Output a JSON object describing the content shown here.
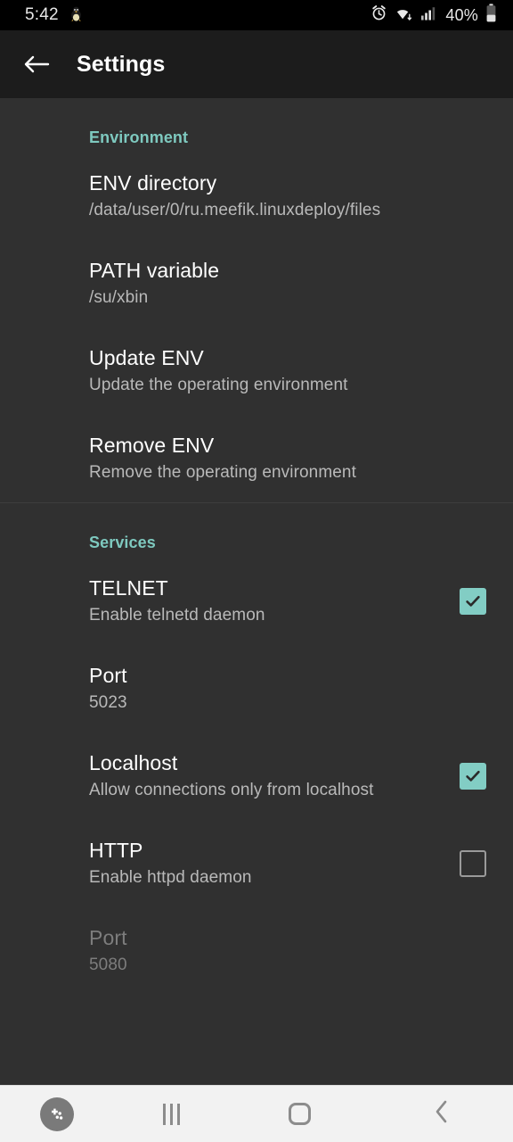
{
  "status_bar": {
    "clock": "5:42",
    "notification_icon": "tux-penguin-icon",
    "alarm_icon": "alarm-clock-icon",
    "wifi_icon": "wifi-icon",
    "signal_icon": "cellular-signal-icon",
    "battery_percent": "40%",
    "battery_icon": "battery-icon"
  },
  "toolbar": {
    "back_icon": "back-arrow-icon",
    "title": "Settings"
  },
  "sections": [
    {
      "header": "Environment",
      "items": [
        {
          "title": "ENV directory",
          "summary": "/data/user/0/ru.meefik.linuxdeploy/files"
        },
        {
          "title": "PATH variable",
          "summary": "/su/xbin"
        },
        {
          "title": "Update ENV",
          "summary": "Update the operating environment"
        },
        {
          "title": "Remove ENV",
          "summary": "Remove the operating environment"
        }
      ]
    },
    {
      "header": "Services",
      "items": [
        {
          "title": "TELNET",
          "summary": "Enable telnetd daemon",
          "checkbox": "checked"
        },
        {
          "title": "Port",
          "summary": "5023"
        },
        {
          "title": "Localhost",
          "summary": "Allow connections only from localhost",
          "checkbox": "checked"
        },
        {
          "title": "HTTP",
          "summary": "Enable httpd daemon",
          "checkbox": "unchecked"
        },
        {
          "title": "Port",
          "summary": "5080",
          "disabled": true
        }
      ]
    }
  ],
  "nav_bar": {
    "game_booster_icon": "gamepad-icon",
    "recents_icon": "recents-icon",
    "home_icon": "home-icon",
    "back_icon": "back-chevron-icon"
  },
  "colors": {
    "accent": "#7ec9bf",
    "checkbox_checked": "#82cdc4",
    "content_background": "#303030",
    "toolbar_background": "#1c1c1c",
    "status_background": "#000000",
    "nav_background": "#f2f2f2"
  }
}
